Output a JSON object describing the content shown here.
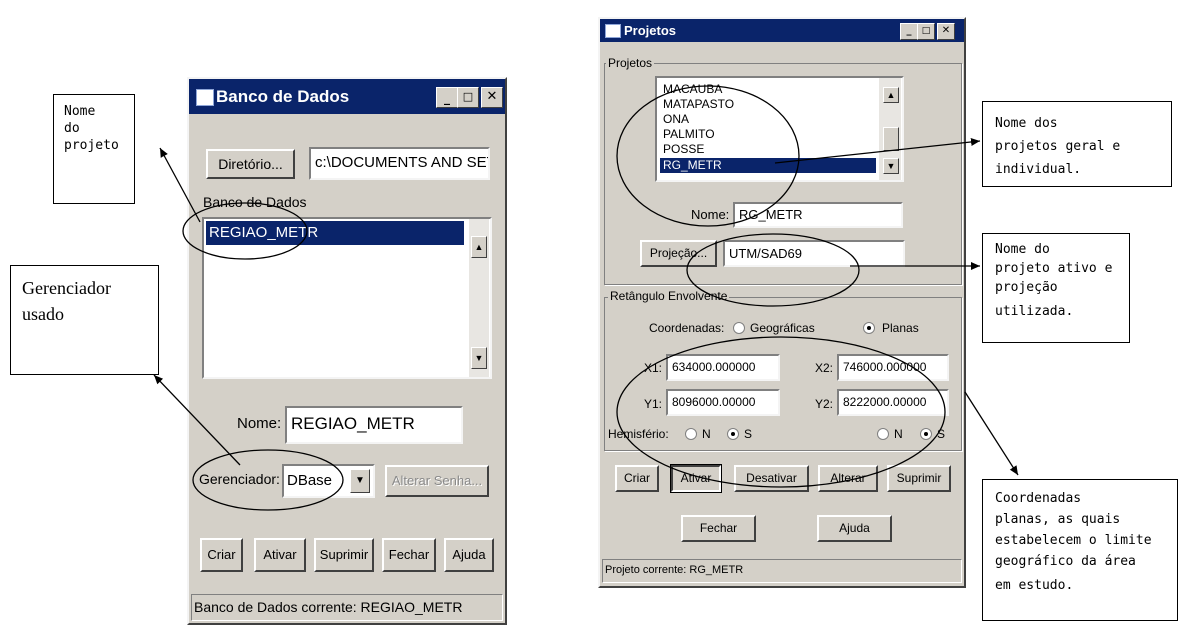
{
  "annotations": {
    "nome_projeto": [
      "Nome",
      "do",
      "projeto"
    ],
    "gerenciador": [
      "Gerenciador",
      "usado"
    ],
    "nome_projetos": [
      "Nome dos",
      "projetos geral e",
      "individual."
    ],
    "projeto_ativo": [
      "Nome do",
      "projeto ativo e",
      "projeção",
      "utilizada."
    ],
    "coordenadas": [
      "Coordenadas",
      "planas, as quais",
      "estabelecem o limite",
      "geográfico da área",
      "em estudo."
    ]
  },
  "banco_dialog": {
    "title": "Banco de Dados",
    "diretorio_button": "Diretório...",
    "diretorio_path": "c:\\DOCUMENTS AND SET",
    "list_label": "Banco de Dados",
    "list_items": [
      "REGIAO_METR"
    ],
    "nome_label": "Nome:",
    "nome_value": "REGIAO_METR",
    "gerenciador_label": "Gerenciador:",
    "gerenciador_value": "DBase",
    "alterar_senha_button": "Alterar Senha...",
    "buttons": [
      "Criar",
      "Ativar",
      "Suprimir",
      "Fechar",
      "Ajuda"
    ],
    "status": "Banco de Dados corrente: REGIAO_METR"
  },
  "projetos_dialog": {
    "title": "Projetos",
    "group_projetos": "Projetos",
    "list_items": [
      "MACAUBA",
      "MATAPASTO",
      "ONA",
      "PALMITO",
      "POSSE",
      "RG_METR"
    ],
    "nome_label": "Nome:",
    "nome_value": "RG_METR",
    "projecao_button": "Projeção...",
    "projecao_value": "UTM/SAD69",
    "group_retangulo": "Retângulo Envolvente",
    "coordenadas_label": "Coordenadas:",
    "coord_options": [
      "Geográficas",
      "Planas"
    ],
    "x1_label": "X1:",
    "x1_value": "634000.000000",
    "x2_label": "X2:",
    "x2_value": "746000.000000",
    "y1_label": "Y1:",
    "y1_value": "8096000.00000",
    "y2_label": "Y2:",
    "y2_value": "8222000.00000",
    "hemisferio_label": "Hemisfério:",
    "hemis_options": [
      "N",
      "S"
    ],
    "buttons": [
      "Criar",
      "Ativar",
      "Desativar",
      "Alterar",
      "Suprimir"
    ],
    "fechar": "Fechar",
    "ajuda": "Ajuda",
    "status": "Projeto corrente: RG_METR"
  },
  "colors": {
    "title_blue": "#0a246a",
    "dialog_gray": "#d4d0c8"
  }
}
